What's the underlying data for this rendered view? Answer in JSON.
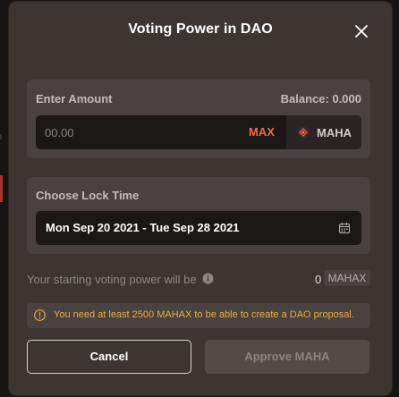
{
  "modal": {
    "title": "Voting Power in DAO"
  },
  "amount": {
    "label": "Enter Amount",
    "balance": "Balance: 0.000",
    "placeholder": "00.00",
    "max_label": "MAX",
    "token_name": "MAHA",
    "token_icon": "maha-token-icon"
  },
  "lock": {
    "label": "Choose Lock Time",
    "date_range": "Mon Sep 20 2021 - Tue Sep 28 2021",
    "icon": "calendar-icon"
  },
  "voting_power": {
    "text": "Your starting voting power will be",
    "value": "0",
    "unit": "MAHAX",
    "icon": "info-icon"
  },
  "warning": {
    "text": "You need at least 2500 MAHAX to be able to create a DAO proposal.",
    "icon": "warning-icon",
    "color": "#e6b13a"
  },
  "buttons": {
    "cancel": "Cancel",
    "approve": "Approve MAHA"
  },
  "colors": {
    "accent": "#f16b46",
    "modal_bg": "#3c3532",
    "panel_bg": "#4a4240"
  }
}
